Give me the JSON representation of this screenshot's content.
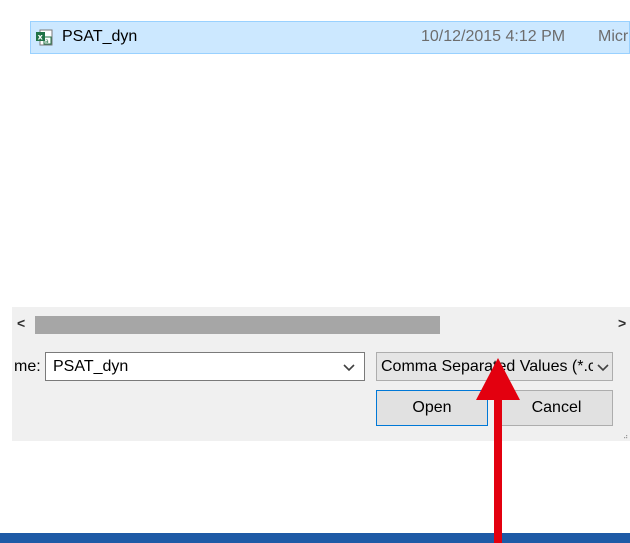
{
  "file_list": {
    "rows": [
      {
        "name": "PSAT_dyn",
        "date_modified": "10/12/2015 4:12 PM",
        "type": "Micr",
        "icon": "excel-csv-icon"
      }
    ]
  },
  "scrollbar": {
    "left_arrow": "<",
    "right_arrow": ">"
  },
  "footer": {
    "file_name_label": "me:",
    "file_name_value": "PSAT_dyn",
    "file_type_value": "Comma Separated Values (*.c",
    "open_label": "Open",
    "cancel_label": "Cancel"
  },
  "colors": {
    "selection_bg": "#cce8ff",
    "selection_border": "#99d1ff",
    "arrow_red": "#e3000f",
    "taskbar": "#1e5aa6",
    "focus_border": "#0078d7"
  },
  "annotation": {
    "icon": "red-arrow-pointer-icon"
  }
}
